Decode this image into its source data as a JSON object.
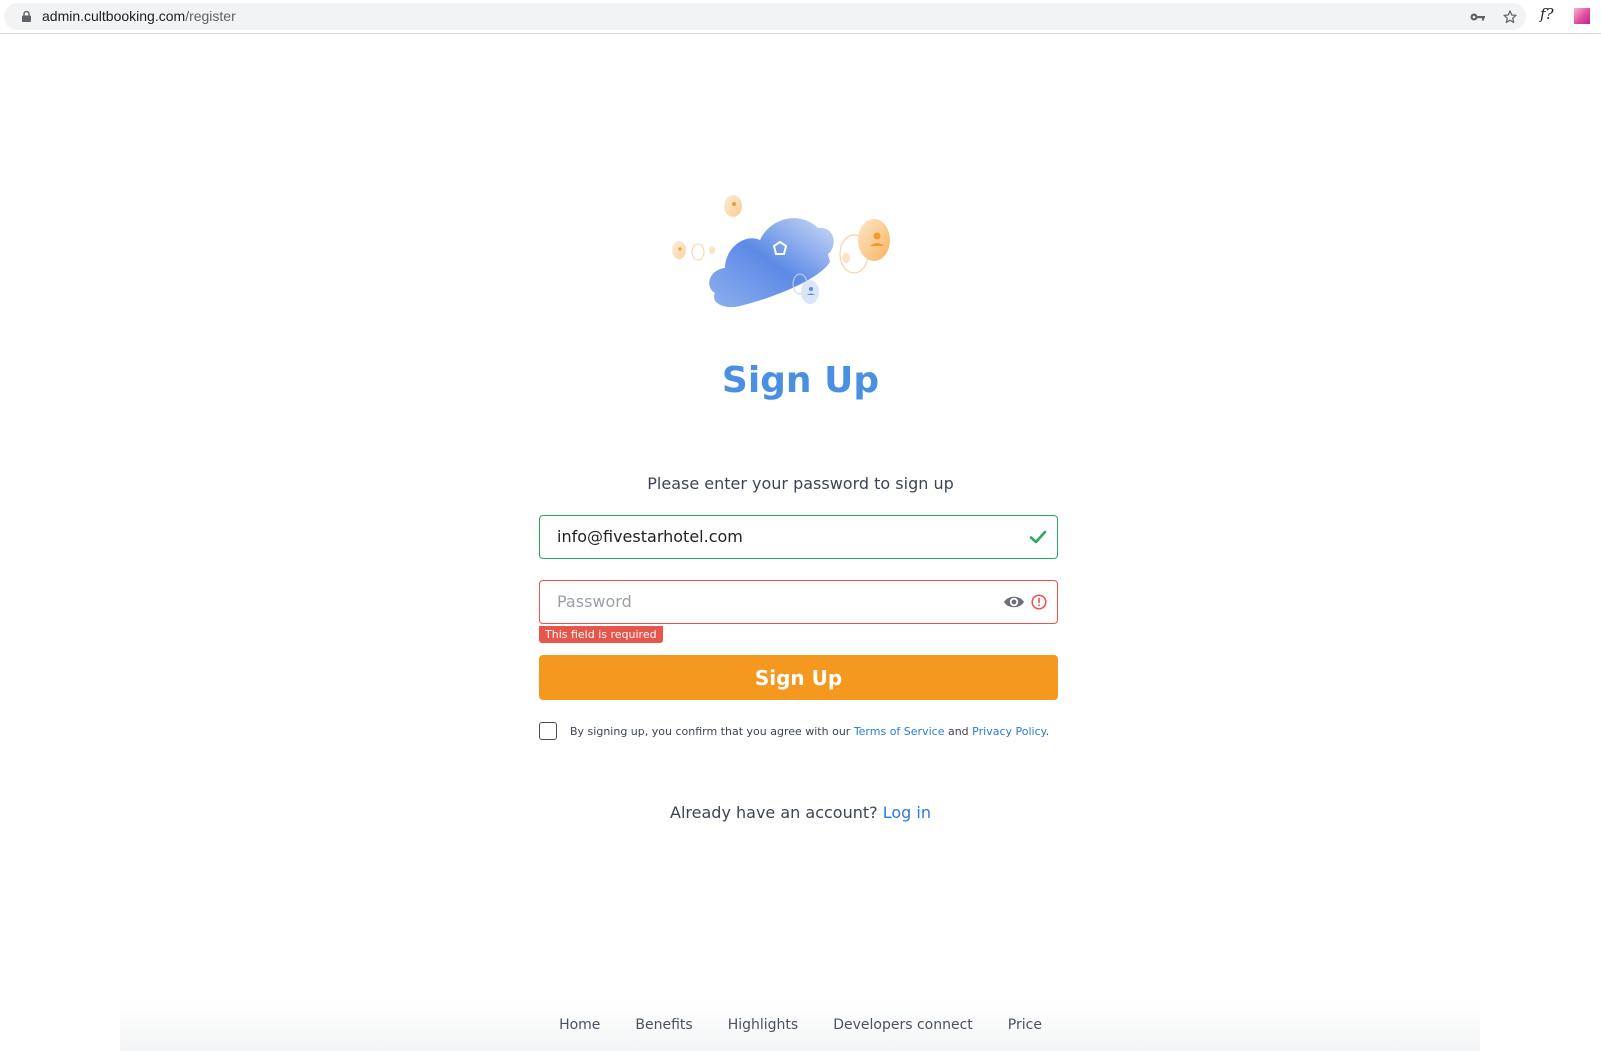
{
  "browser": {
    "url_host": "admin.cultbooking.com",
    "url_path": "/register",
    "extension_label": "f?"
  },
  "page": {
    "title": "Sign Up",
    "subtitle": "Please enter your password to sign up"
  },
  "form": {
    "email_value": "info@fivestarhotel.com",
    "email_status": "valid",
    "password_value": "",
    "password_placeholder": "Password",
    "password_status": "error",
    "password_error": "This field is required",
    "submit_label": "Sign Up",
    "terms_checked": false,
    "terms_prefix": "By signing up, you confirm that you agree with our ",
    "terms_link": "Terms of Service",
    "terms_and": " and ",
    "privacy_link": "Privacy Policy",
    "terms_suffix": "."
  },
  "login": {
    "prompt": "Already have an account? ",
    "link": "Log in"
  },
  "footer": {
    "links": [
      "Home",
      "Benefits",
      "Highlights",
      "Developers connect",
      "Price"
    ]
  },
  "colors": {
    "brand_blue": "#4a90e2",
    "accent_orange": "#f5981f",
    "valid_green": "#2bab5a",
    "error_red": "#e5564b"
  }
}
